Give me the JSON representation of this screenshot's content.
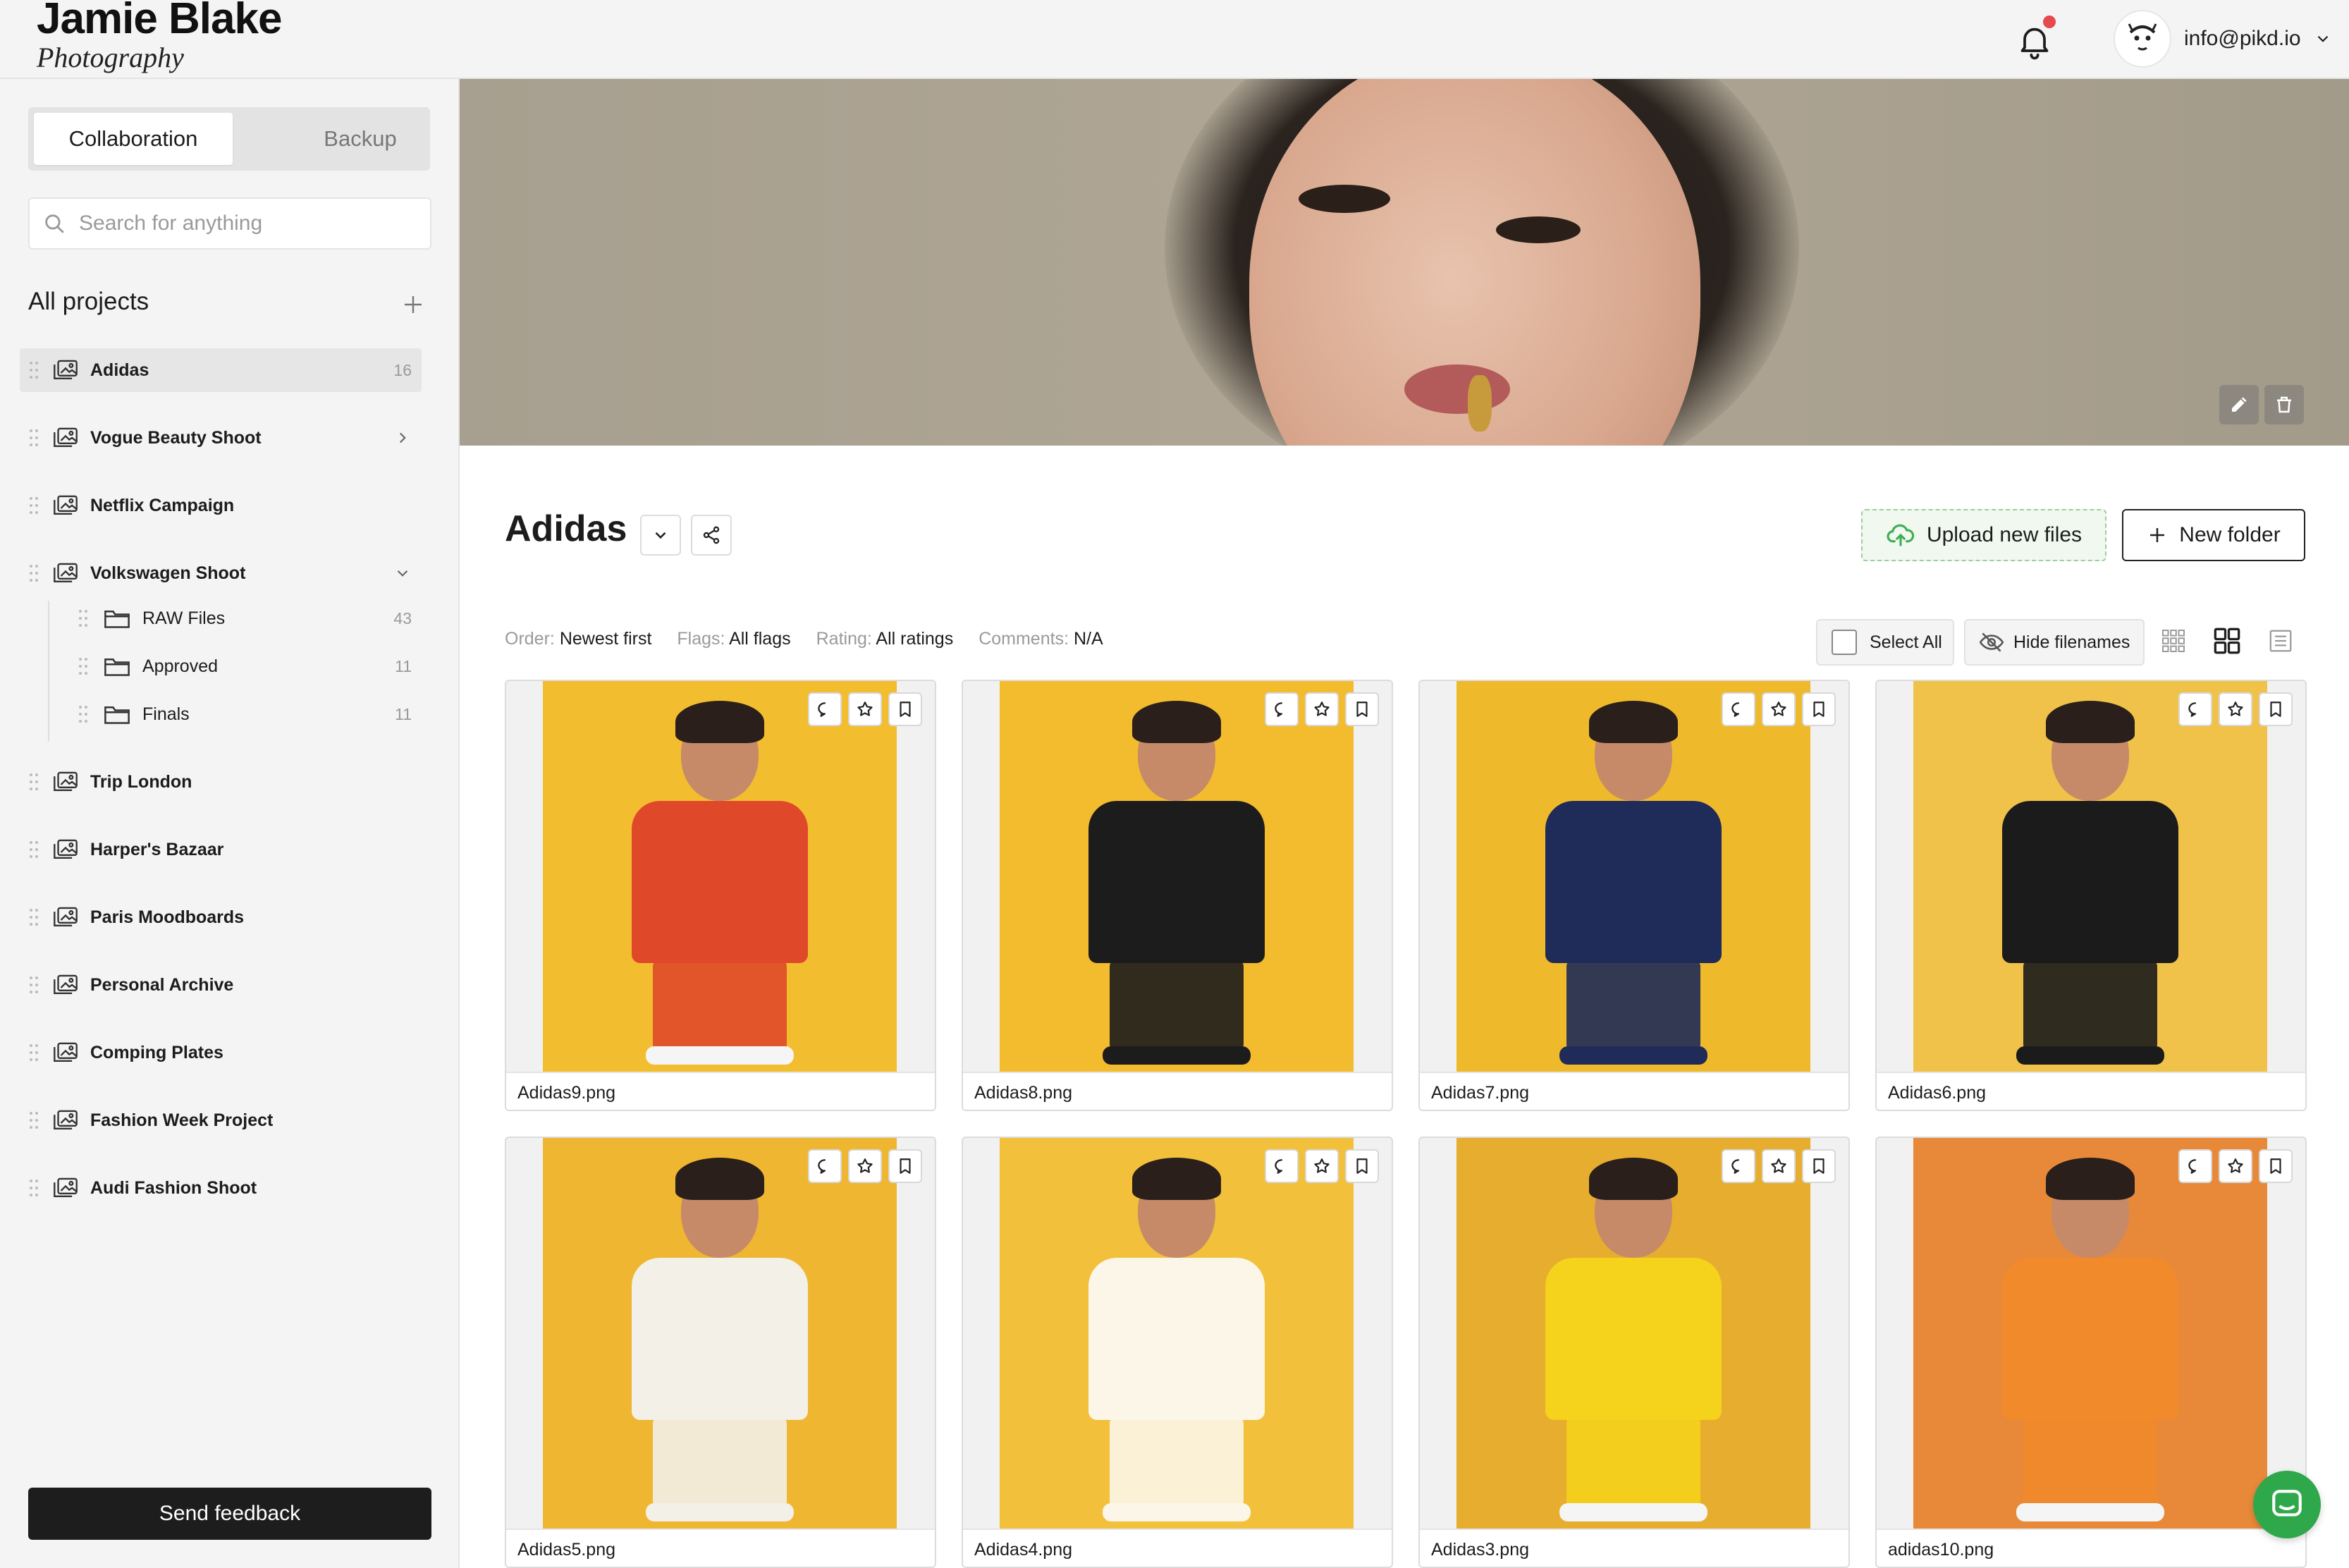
{
  "brand": {
    "name": "Jamie Blake",
    "subtitle": "Photography"
  },
  "account": {
    "email": "info@pikd.io",
    "has_unread_notifications": true
  },
  "sidebar": {
    "tabs": [
      {
        "label": "Collaboration",
        "active": true
      },
      {
        "label": "Backup",
        "active": false
      }
    ],
    "search_placeholder": "Search for anything",
    "projects_heading": "All projects",
    "projects": [
      {
        "name": "Adidas",
        "count": "16",
        "active": true
      },
      {
        "name": "Vogue Beauty Shoot",
        "chevron": "right"
      },
      {
        "name": "Netflix Campaign"
      },
      {
        "name": "Volkswagen Shoot",
        "chevron": "down",
        "folders": [
          {
            "name": "RAW Files",
            "count": "43"
          },
          {
            "name": "Approved",
            "count": "11"
          },
          {
            "name": "Finals",
            "count": "11"
          }
        ]
      },
      {
        "name": "Trip London"
      },
      {
        "name": "Harper's Bazaar"
      },
      {
        "name": "Paris Moodboards"
      },
      {
        "name": "Personal Archive"
      },
      {
        "name": "Comping Plates"
      },
      {
        "name": "Fashion Week Project"
      },
      {
        "name": "Audi Fashion Shoot"
      }
    ],
    "feedback_label": "Send feedback"
  },
  "main": {
    "title": "Adidas",
    "upload_label": "Upload new files",
    "new_folder_label": "New folder",
    "filters": [
      {
        "label": "Order:",
        "value": "Newest first"
      },
      {
        "label": "Flags:",
        "value": "All flags"
      },
      {
        "label": "Rating:",
        "value": "All ratings"
      },
      {
        "label": "Comments:",
        "value": "N/A"
      }
    ],
    "select_all_label": "Select All",
    "hide_filenames_label": "Hide filenames",
    "active_view": "grid-medium",
    "images": [
      {
        "filename": "Adidas9.png",
        "bg": "#f2bd2f",
        "outfit": "#e0482a",
        "shoes": "#f5f5f5"
      },
      {
        "filename": "Adidas8.png",
        "bg": "#f3bb2e",
        "outfit": "#1c1c1c",
        "shoes": "#1c1c1c"
      },
      {
        "filename": "Adidas7.png",
        "bg": "#efb92c",
        "outfit": "#1f2b58",
        "shoes": "#1f2b58"
      },
      {
        "filename": "Adidas6.png",
        "bg": "#f0c24a",
        "outfit": "#1b1b1b",
        "shoes": "#1b1b1b"
      },
      {
        "filename": "Adidas5.png",
        "bg": "#efb631",
        "outfit": "#f3f0e8",
        "shoes": "#f3f0e8"
      },
      {
        "filename": "Adidas4.png",
        "bg": "#f2c03a",
        "outfit": "#fbf6e8",
        "shoes": "#fbf6e8"
      },
      {
        "filename": "Adidas3.png",
        "bg": "#e7ad2e",
        "outfit": "#f5d21c",
        "shoes": "#f5f5f5"
      },
      {
        "filename": "adidas10.png",
        "bg": "#e8893a",
        "outfit": "#f08a2a",
        "shoes": "#f5f5f5"
      }
    ]
  },
  "colors": {
    "accent": "#2ea84a",
    "notification": "#e5484d",
    "dark_button": "#1d1d1d"
  },
  "icons": [
    "bell-icon",
    "chevron-down-icon",
    "search-icon",
    "plus-icon",
    "drag-handle-icon",
    "gallery-icon",
    "folder-icon",
    "chevron-right-icon",
    "share-icon",
    "upload-cloud-icon",
    "pencil-icon",
    "trash-icon",
    "eye-off-icon",
    "grid-small-icon",
    "grid-large-icon",
    "list-icon",
    "comment-icon",
    "star-icon",
    "bookmark-icon",
    "chat-icon"
  ]
}
